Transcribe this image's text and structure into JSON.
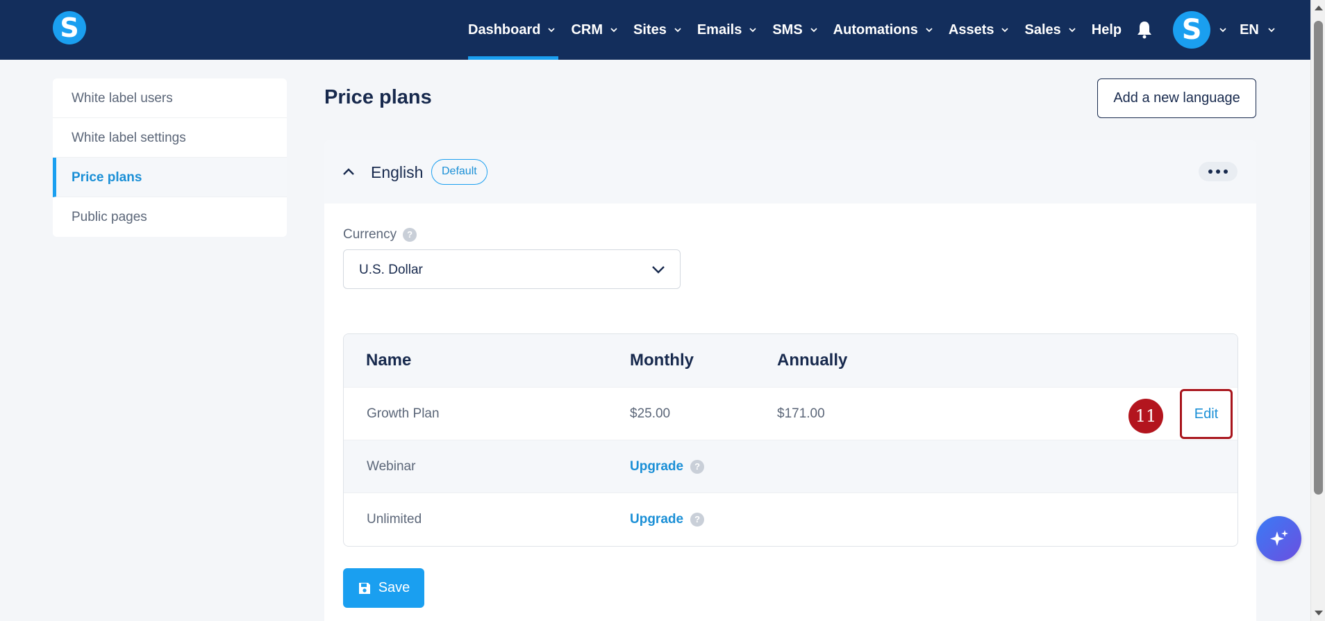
{
  "brand": {
    "logo_letter": "S"
  },
  "nav": {
    "items": [
      {
        "label": "Dashboard"
      },
      {
        "label": "CRM"
      },
      {
        "label": "Sites"
      },
      {
        "label": "Emails"
      },
      {
        "label": "SMS"
      },
      {
        "label": "Automations"
      },
      {
        "label": "Assets"
      },
      {
        "label": "Sales"
      }
    ],
    "help_label": "Help",
    "avatar_letter": "S",
    "language": "EN",
    "active_item": "Dashboard"
  },
  "sidebar": {
    "items": [
      {
        "label": "White label users"
      },
      {
        "label": "White label settings"
      },
      {
        "label": "Price plans"
      },
      {
        "label": "Public pages"
      }
    ],
    "active_item": "Price plans"
  },
  "main": {
    "title": "Price plans",
    "add_language_label": "Add a new language",
    "language_section": {
      "name": "English",
      "badge": "Default",
      "currency_label": "Currency",
      "currency_value": "U.S. Dollar",
      "table": {
        "headers": {
          "name": "Name",
          "monthly": "Monthly",
          "annually": "Annually"
        },
        "rows": [
          {
            "name": "Growth Plan",
            "monthly": "$25.00",
            "annually": "$171.00",
            "action": "Edit"
          },
          {
            "name": "Webinar",
            "monthly": "Upgrade"
          },
          {
            "name": "Unlimited",
            "monthly": "Upgrade"
          }
        ]
      },
      "save_label": "Save"
    }
  },
  "annotation": {
    "step_number": "11"
  },
  "colors": {
    "topbar": "#132e5c",
    "accent": "#1a9ff0",
    "highlight": "#a8141c"
  }
}
